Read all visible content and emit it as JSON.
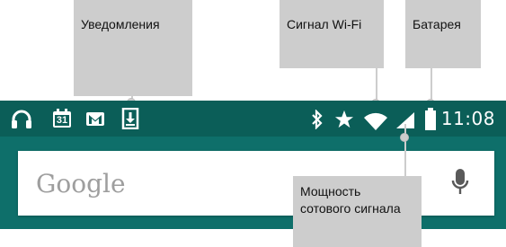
{
  "callouts": {
    "notifications": "Уведомления",
    "wifi_signal": "Сигнал Wi-Fi",
    "battery": "Батарея",
    "cell_signal": "Мощность сотового сигнала"
  },
  "status_bar": {
    "time": "11:08",
    "calendar_day": "31",
    "notification_icons": [
      "headphones-icon",
      "calendar-icon",
      "gmail-icon",
      "download-icon"
    ],
    "system_icons": [
      "bluetooth-icon",
      "star-icon",
      "wifi-icon",
      "cell-signal-icon",
      "battery-icon"
    ]
  },
  "search": {
    "logo_text": "Google",
    "mic_icon": "mic-icon"
  },
  "colors": {
    "status_bar": "#0b5e58",
    "wallpaper": "#0e6f6a",
    "callout": "#cdcdcd"
  }
}
